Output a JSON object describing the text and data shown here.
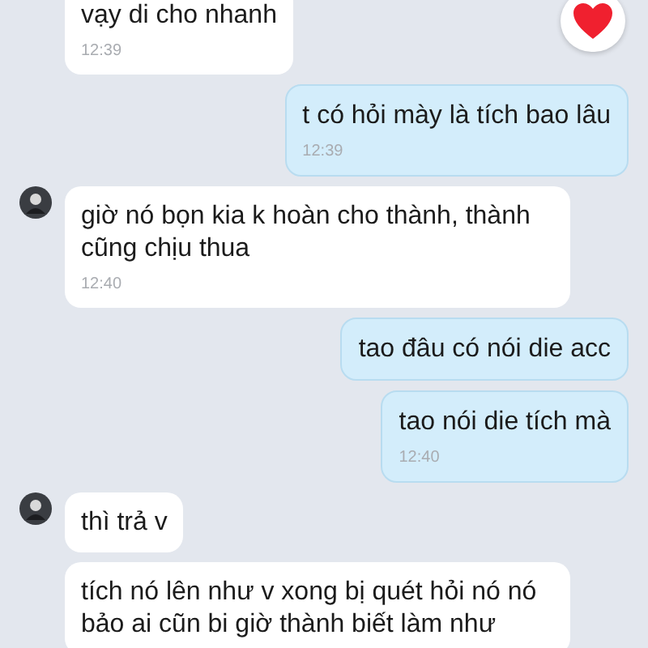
{
  "messages": [
    {
      "kind": "received",
      "text": "vạy di cho nhanh",
      "time": "12:39",
      "avatar": false,
      "reacted": true
    },
    {
      "kind": "sent",
      "text": "t có hỏi mày là tích bao lâu",
      "time": "12:39"
    },
    {
      "kind": "received",
      "text": "giờ nó bọn kia k hoàn cho thành, thành cũng chịu thua",
      "time": "12:40",
      "avatar": true,
      "reacted": false
    },
    {
      "kind": "sent",
      "text": "tao đâu có nói die acc"
    },
    {
      "kind": "sent",
      "text": "tao nói die tích mà",
      "time": "12:40"
    },
    {
      "kind": "received",
      "text": "thì trả v",
      "avatar": true,
      "reacted": false
    },
    {
      "kind": "received",
      "text": "tích nó lên như v xong bị quét hỏi nó nó bảo ai cũn bi giờ thành biết làm như",
      "avatar": false,
      "reacted": false
    }
  ]
}
